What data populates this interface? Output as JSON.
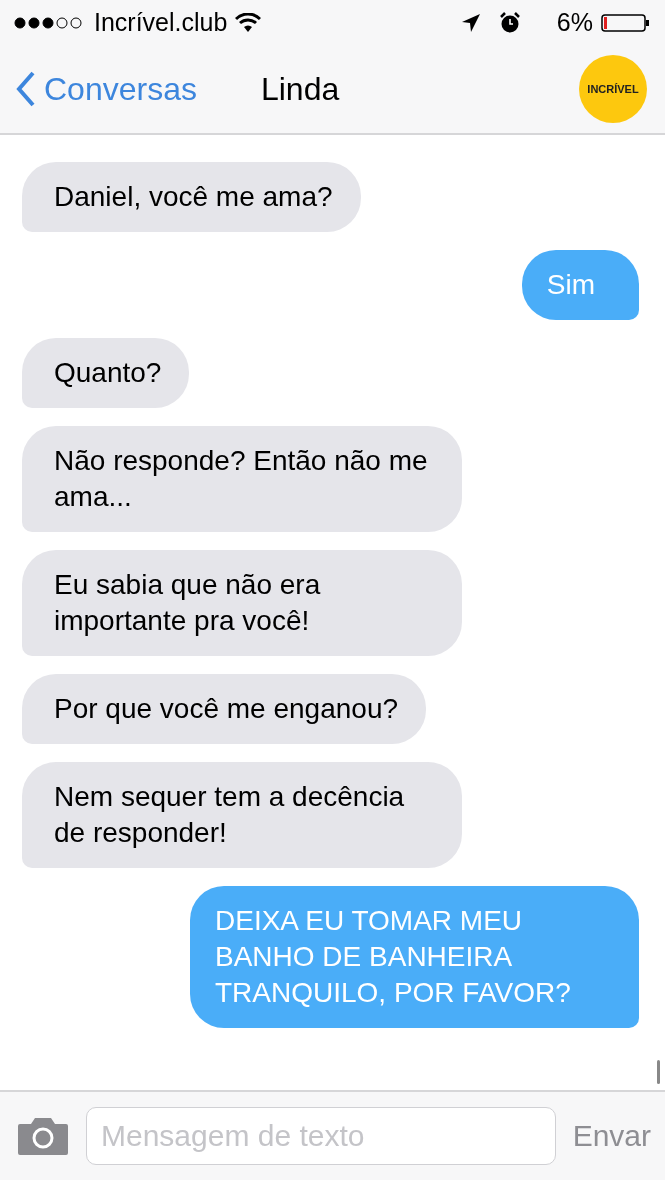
{
  "status_bar": {
    "carrier": "Incrível.club",
    "battery": "6%"
  },
  "nav": {
    "back": "Conversas",
    "title": "Linda",
    "logo": "INCRÍVEL"
  },
  "messages": [
    {
      "kind": "received",
      "text": "Daniel, você me ama?"
    },
    {
      "kind": "sent",
      "text": "Sim"
    },
    {
      "kind": "received",
      "text": "Quanto?"
    },
    {
      "kind": "received",
      "text": "Não responde? Então não me ama..."
    },
    {
      "kind": "received",
      "text": "Eu sabia que não era importante pra você!"
    },
    {
      "kind": "received",
      "text": "Por que você me enganou?"
    },
    {
      "kind": "received",
      "text": "Nem sequer tem a decência de responder!"
    },
    {
      "kind": "sent",
      "text": "DEIXA EU TOMAR MEU BANHO DE BANHEIRA TRANQUILO, POR FAVOR?"
    }
  ],
  "composer": {
    "placeholder": "Mensagem de texto",
    "send": "Envar"
  }
}
